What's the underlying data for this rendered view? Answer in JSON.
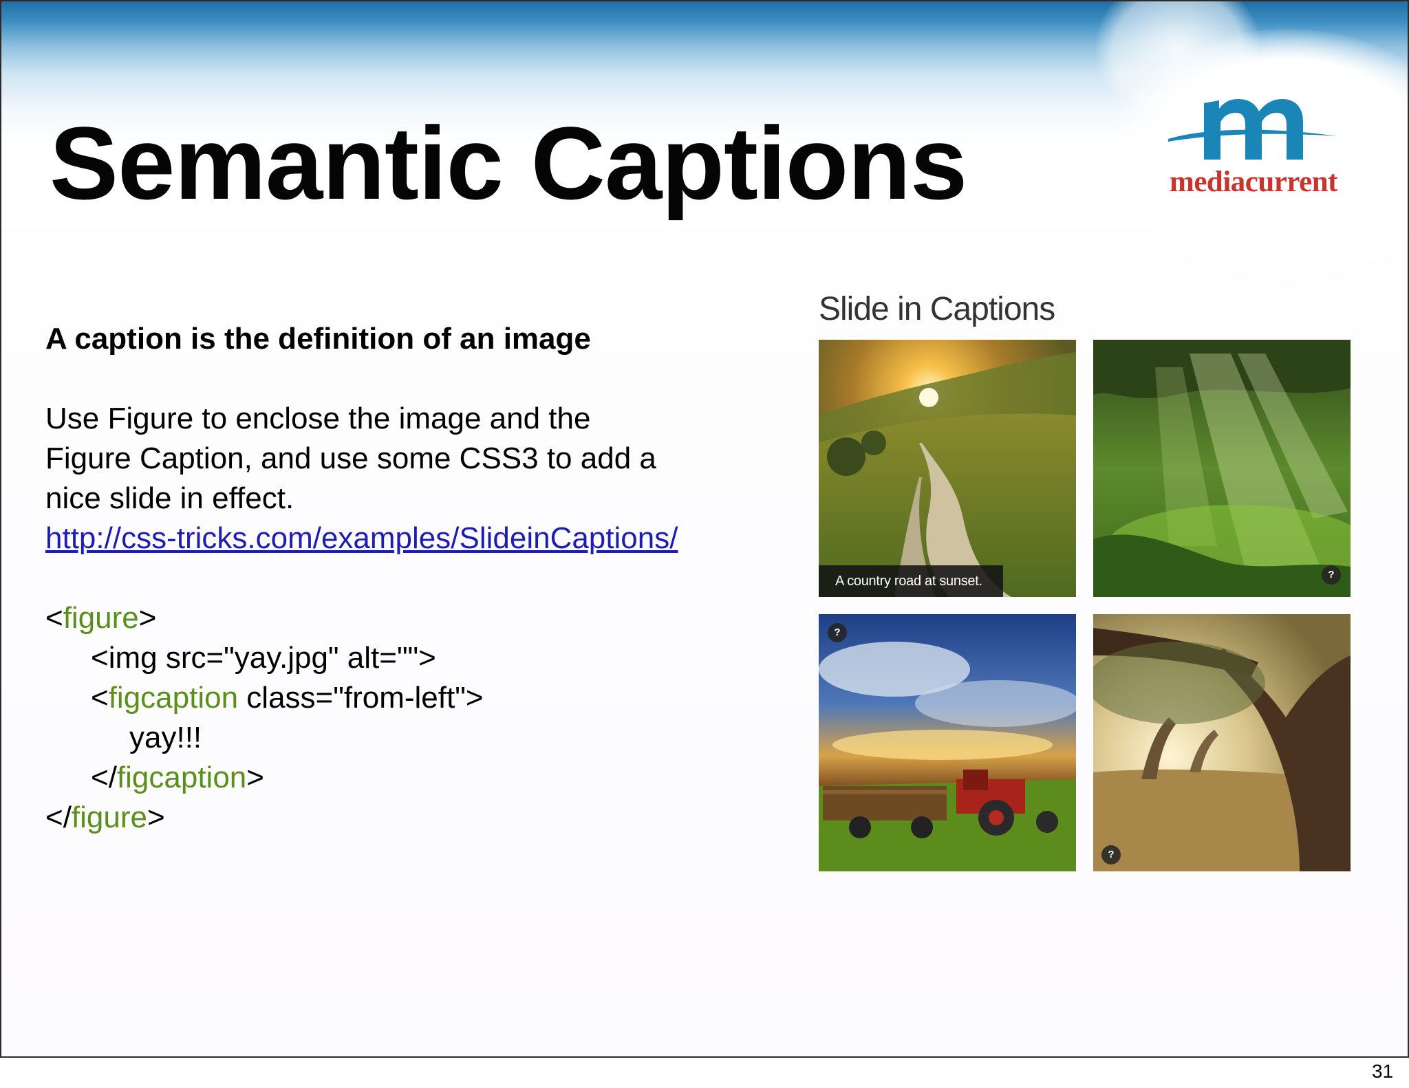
{
  "slide": {
    "title": "Semantic Captions",
    "logo_text": "mediacurrent",
    "lead": "A caption is the definition of an image",
    "paragraph": [
      "Use Figure to enclose the image and the",
      "Figure Caption, and use some CSS3 to add a",
      "nice slide in effect."
    ],
    "link": "http://css-tricks.com/examples/SlideinCaptions/",
    "code": {
      "l1_open": "<",
      "l1_tag": "figure",
      "l1_close": ">",
      "l2": "<img src=\"yay.jpg\" alt=\"\">",
      "l3_open": "<",
      "l3_tag": "figcaption",
      "l3_attr": " class=\"from-left\">",
      "l4": "yay!!!",
      "l5_open": "</",
      "l5_tag": "figcaption",
      "l5_close": ">",
      "l6_open": "</",
      "l6_tag": "figure",
      "l6_close": ">"
    },
    "page_number": "31"
  },
  "demo": {
    "title": "Slide in Captions",
    "caption": "A country road at sunset.",
    "help_glyph": "?"
  },
  "colors": {
    "code_keyword": "#5b8f1c",
    "link": "#1d1db3",
    "logo_blue": "#1a86b8",
    "logo_red": "#c8352d"
  }
}
